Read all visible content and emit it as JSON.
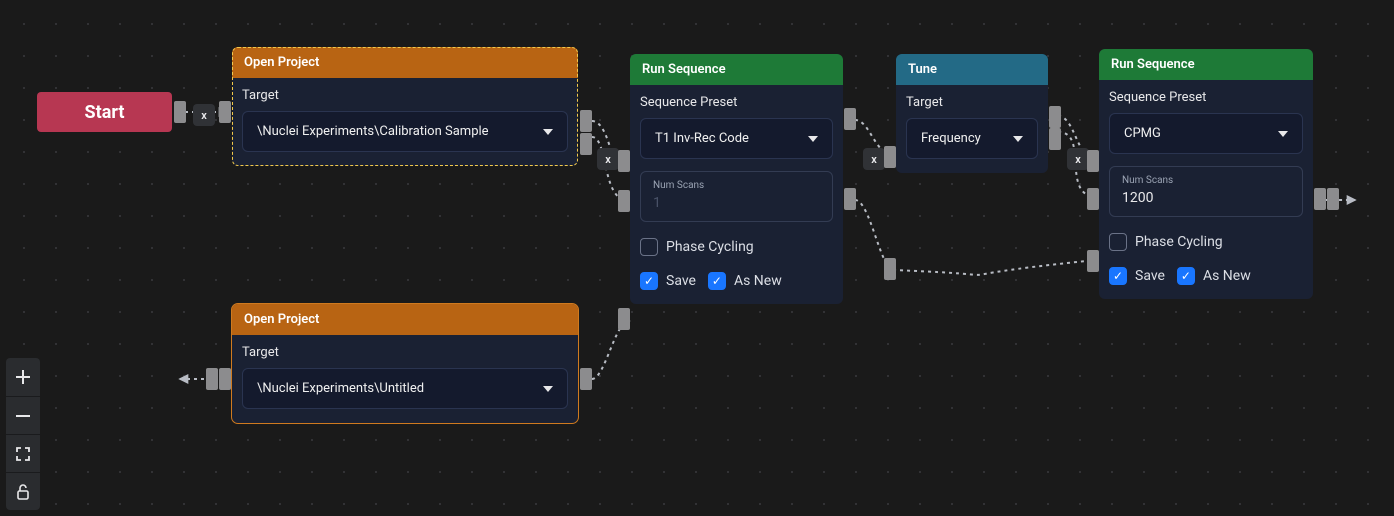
{
  "nodes": {
    "start": {
      "label": "Start"
    },
    "open_project_1": {
      "header": "Open Project",
      "target_label": "Target",
      "target_value": "\\Nuclei Experiments\\Calibration Sample"
    },
    "open_project_2": {
      "header": "Open Project",
      "target_label": "Target",
      "target_value": "\\Nuclei Experiments\\Untitled"
    },
    "run_sequence_1": {
      "header": "Run Sequence",
      "preset_label": "Sequence Preset",
      "preset_value": "T1 Inv-Rec Code",
      "numscans_label": "Num Scans",
      "numscans_value": "1",
      "phase_label": "Phase Cycling",
      "phase_checked": false,
      "save_label": "Save",
      "save_checked": true,
      "asnew_label": "As New",
      "asnew_checked": true
    },
    "tune": {
      "header": "Tune",
      "target_label": "Target",
      "target_value": "Frequency"
    },
    "run_sequence_2": {
      "header": "Run Sequence",
      "preset_label": "Sequence Preset",
      "preset_value": "CPMG",
      "numscans_label": "Num Scans",
      "numscans_value": "1200",
      "phase_label": "Phase Cycling",
      "phase_checked": false,
      "save_label": "Save",
      "save_checked": true,
      "asnew_label": "As New",
      "asnew_checked": true
    }
  },
  "toolbar": {
    "zoom_in": "+",
    "zoom_out": "−",
    "fit": "⛶",
    "lock": "🔓"
  },
  "symbols": {
    "close": "x"
  },
  "colors": {
    "orange": "#b86413",
    "green": "#1e7a37",
    "teal": "#236a86",
    "start": "#b73752",
    "selection": "#f2c94c",
    "check_blue": "#1976ff",
    "bg": "#1a1a1a",
    "node_bg": "#1a2133"
  }
}
